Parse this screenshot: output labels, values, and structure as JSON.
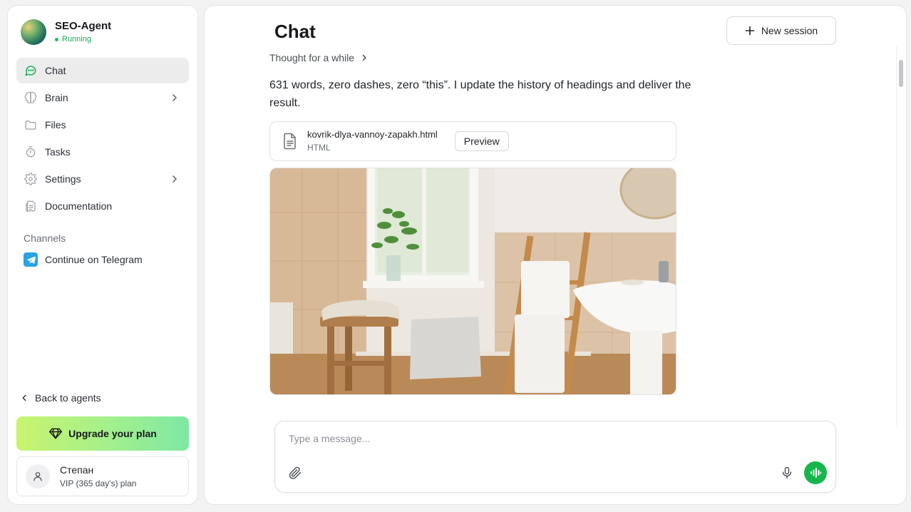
{
  "agent": {
    "name": "SEO-Agent",
    "status": "Running"
  },
  "nav": {
    "items": [
      {
        "label": "Chat",
        "icon": "chat-bubble-icon",
        "active": true
      },
      {
        "label": "Brain",
        "icon": "brain-icon",
        "has_submenu": true
      },
      {
        "label": "Files",
        "icon": "folder-icon"
      },
      {
        "label": "Tasks",
        "icon": "timer-icon"
      },
      {
        "label": "Settings",
        "icon": "gear-icon",
        "has_submenu": true
      },
      {
        "label": "Documentation",
        "icon": "document-icon"
      }
    ]
  },
  "channels": {
    "heading": "Channels",
    "telegram_label": "Continue on Telegram"
  },
  "footer": {
    "back_label": "Back to agents",
    "upgrade_label": "Upgrade your plan",
    "user_name": "Степан",
    "user_plan": "VIP (365 day's) plan"
  },
  "main": {
    "title": "Chat",
    "new_session_label": "New session",
    "thought_label": "Thought for a while",
    "message": "631 words, zero dashes, zero “this”. I update the history of headings and deliver the result.",
    "file": {
      "name": "kovrik-dlya-vannoy-zapakh.html",
      "type": "HTML",
      "preview_label": "Preview"
    }
  },
  "composer": {
    "placeholder": "Type a message..."
  },
  "colors": {
    "accent_green": "#16b74a",
    "status_green": "#18a957",
    "telegram_blue": "#2aa3e0",
    "active_nav_bg": "#ececed"
  }
}
